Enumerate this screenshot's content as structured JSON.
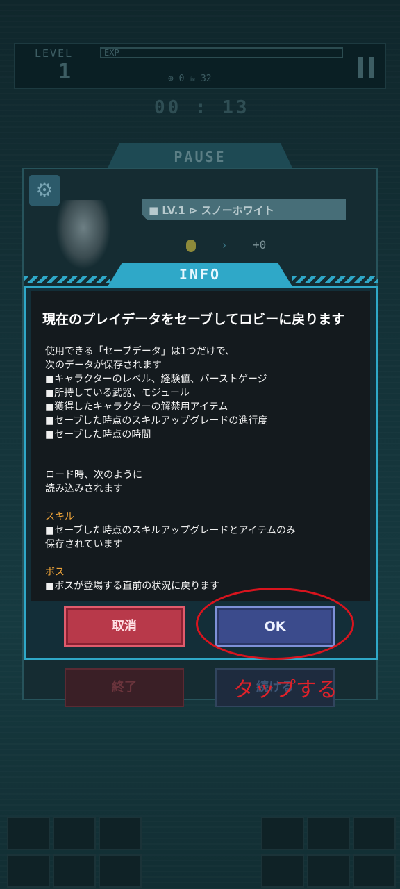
{
  "hud": {
    "level_label": "LEVEL",
    "level_value": "1",
    "exp_label": "EXP",
    "stats": "⊕ 0 ☠ 32",
    "timer": "00 : 13"
  },
  "pause": {
    "title": "PAUSE",
    "character_name": "■ LV.1 ⊳ スノーホワイト",
    "character_bonus": "+0",
    "end_label": "終了",
    "continue_label": "続ける"
  },
  "info": {
    "tab_title": "INFO",
    "heading": "現在のプレイデータをセーブしてロビーに戻ります",
    "lines": [
      "使用できる「セーブデータ」は1つだけで、",
      "次のデータが保存されます",
      "■キャラクターのレベル、経験値、バーストゲージ",
      "■所持している武器、モジュール",
      "■獲得したキャラクターの解禁用アイテム",
      "■セーブした時点のスキルアップグレードの進行度",
      "■セーブした時点の時間",
      "ロード時、次のように",
      "読み込みされます",
      "■セーブした時点のスキルアップグレードとアイテムのみ",
      "保存されています",
      "■ボスが登場する直前の状況に戻ります"
    ],
    "section_skill": "スキル",
    "section_boss": "ボス",
    "cancel_label": "取消",
    "ok_label": "OK"
  },
  "annotation": {
    "text": "タップする",
    "color": "#e0222a"
  },
  "colors": {
    "accent": "#2fa8c8",
    "cancel": "#b8394a",
    "ok": "#3b4b8c",
    "section": "#f0a53a"
  }
}
